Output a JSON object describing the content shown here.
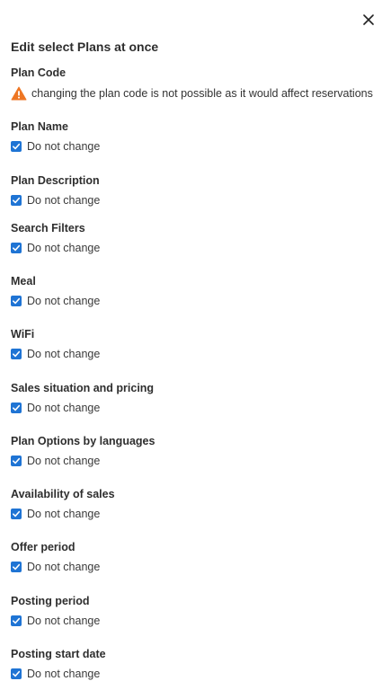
{
  "title": "Edit select Plans at once",
  "plan_code": {
    "label": "Plan Code",
    "warning": "changing the plan code is not possible as it would affect reservations"
  },
  "fields": [
    {
      "label": "Plan Name",
      "option": "Do not change",
      "checked": true
    },
    {
      "label": "Plan Description",
      "option": "Do not change",
      "checked": true
    },
    {
      "label": "Search Filters",
      "option": "Do not change",
      "checked": true
    },
    {
      "label": "Meal",
      "option": "Do not change",
      "checked": true
    },
    {
      "label": "WiFi",
      "option": "Do not change",
      "checked": true
    },
    {
      "label": "Sales situation and pricing",
      "option": "Do not change",
      "checked": true
    },
    {
      "label": "Plan Options by languages",
      "option": "Do not change",
      "checked": true
    },
    {
      "label": "Availability of sales",
      "option": "Do not change",
      "checked": true
    },
    {
      "label": "Offer period",
      "option": "Do not change",
      "checked": true
    },
    {
      "label": "Posting period",
      "option": "Do not change",
      "checked": true
    },
    {
      "label": "Posting start date",
      "option": "Do not change",
      "checked": true
    }
  ],
  "icons": {
    "close": "close-icon",
    "warning": "warning-icon",
    "checkbox": "checkmark-icon"
  },
  "colors": {
    "checkbox": "#1f74d4",
    "warning": "#ee7623",
    "text": "#2e2e2e"
  }
}
